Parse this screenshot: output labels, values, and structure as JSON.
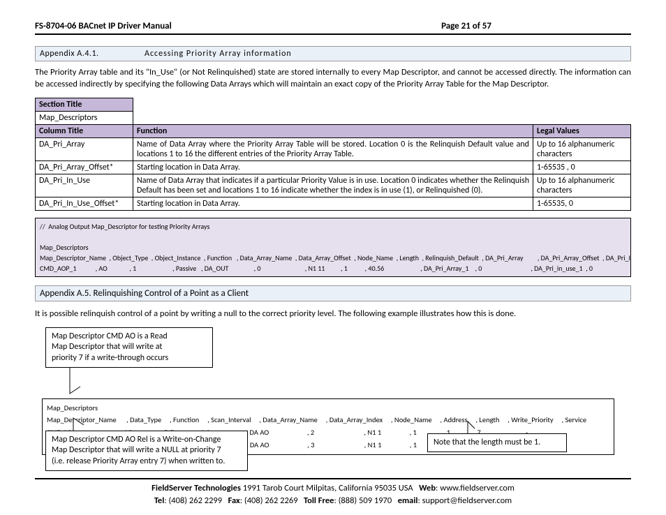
{
  "header": {
    "title": "FS-8704-06 BACnet IP Driver Manual",
    "page": "Page 21 of 57"
  },
  "sectionA41": {
    "num": "Appendix A.4.1.",
    "txt": "Accessing Priority Array information"
  },
  "introA41": "The Priority Array table and its \"In_Use\" (or Not Relinquished) state are stored internally to every Map Descriptor, and cannot be accessed directly.   The information can be accessed indirectly by specifying the following Data Arrays which will maintain an exact copy of the Priority Array Table for the Map Descriptor.",
  "table1": {
    "sectionTitleLabel": "Section Title",
    "sectionTitleValue": "Map_Descriptors",
    "colTitleLabel": "Column Title",
    "functionLabel": "Function",
    "legalLabel": "Legal Values",
    "rows": [
      {
        "col": "DA_Pri_Array",
        "func": "Name of Data Array where the Priority Array Table will be stored.  Location 0 is the Relinquish Default value and locations 1 to 16 the different entries of the Priority Array Table.",
        "legal": "Up to 16 alphanumeric characters"
      },
      {
        "col": "DA_Pri_Array_Offset*",
        "func": "Starting location in Data Array.",
        "legal": "1-65535 , 0"
      },
      {
        "col": "DA_Pri_In_Use",
        "func": "Name of Data Array that indicates if a particular Priority Value is in use.  Location 0 indicates whether the Relinquish Default has been set and locations 1 to 16 indicate whether the index is in use (1), or Relinquished (0).",
        "legal": "Up to 16 alphanumeric characters"
      },
      {
        "col": "DA_Pri_In_Use_Offset*",
        "func": "Starting location in Data Array.",
        "legal": "1-65535, 0"
      }
    ]
  },
  "code1": {
    "comment": "//  Analog Output Map_Descriptor for testing Priority Arrays",
    "blank": "",
    "l1": "Map_Descriptors",
    "l2": "Map_Descriptor_Name  , Object_Type  , Object_Instance  , Function   , Data_Array_Name  , Data_Array_Offset  , Node_Name  , Length  , Relinquish_Default  , DA_Pri_Array         , DA_Pri_Array_Offset  , DA_Pri_In_Use        , DA_Pri_In_Use_Offset",
    "l3": "CMD_AOP_1            , AO              , 1                       , Passive   , DA_OUT                , 0                            , N1 11          , 1           , 40.56                       , DA_Pri_Array_1    , 0                               , DA_Pri_in_use_1  , 0"
  },
  "sectionA5": "Appendix A.5. Relinquishing Control of a Point as a Client",
  "introA5": "It is possible relinquish control of a point by writing a null to the correct priority level.  The following example illustrates how this is done.",
  "callout1": "Map Descriptor CMD AO is a Read\nMap Descriptor that will write at\npriority 7 if a write-through occurs",
  "callout2": "Map Descriptor CMD AO Rel is a Write-on-Change\nMap Descriptor that will write a NULL at priority 7\n(i.e. release Priority Array entry 7) when written to.",
  "callout3": "Note that the length must be 1.",
  "config2": {
    "l1": "Map_Descriptors",
    "l2": "Map_Descriptor_Name      , Data_Type     , Function     , Scan_Interval     , Data_Array_Name     , Data_Array_Index     , Node_Name     , Address     , Length     , Write_Priority     , Service",
    "l3": "CMD AO                             , AO                 , Rdbc           , 1.0s                    , DA AO                       , 2                              , N1 1                 , 1                , 1              , 7                         , -",
    "l4": "CMD AO Rel                       , AO                 , Wrbx          , 1.0s                    , DA AO                       , 3                              , N1 1                 , 1                , 1              , 7                         , Relinquish"
  },
  "footer": {
    "company": "FieldServer Technologies",
    "addr": "1991 Tarob Court Milpitas, California 95035 USA",
    "webLabel": "Web",
    "web": ": www.fieldserver.com",
    "telLabel": "Tel",
    "tel": ": (408) 262 2299",
    "faxLabel": "Fax",
    "fax": ": (408) 262 2269",
    "tollLabel": "Toll Free",
    "toll": ": (888) 509 1970",
    "emailLabel": "email",
    "email": ": support@fieldserver.com"
  }
}
